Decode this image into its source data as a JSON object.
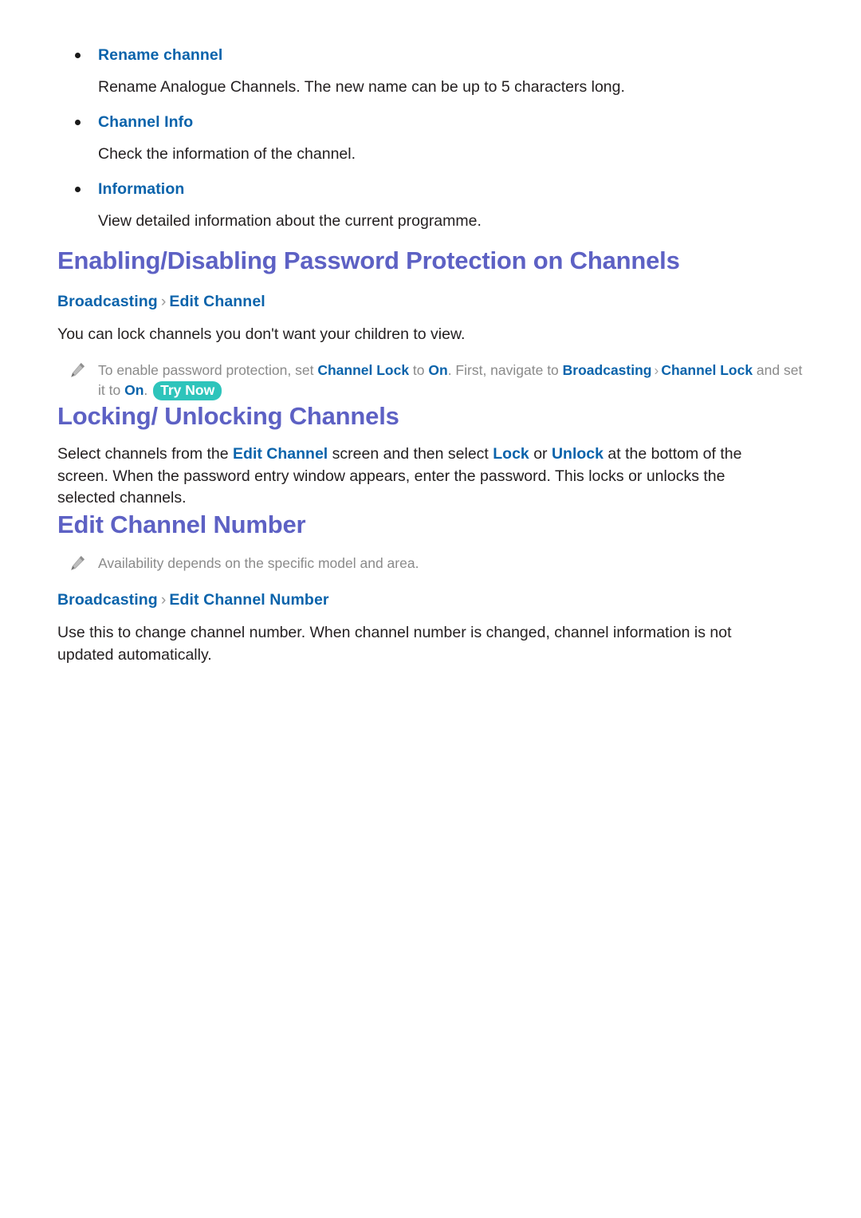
{
  "page": {
    "background": "#ffffff",
    "link_color": "#0a63ab",
    "heading_color": "#5d61c4",
    "body_color": "#231f20",
    "tip_color": "#8a8a8a",
    "badge_color": "#2ec4bb"
  },
  "bullets": [
    {
      "label": "Rename channel",
      "description": "Rename Analogue Channels. The new name can be up to 5 characters long."
    },
    {
      "label": "Channel Info",
      "description": "Check the information of the channel."
    },
    {
      "label": "Information",
      "description": "View detailed information about the current programme."
    }
  ],
  "sections": [
    {
      "title": "Enabling/Disabling Password Protection on Channels",
      "breadcrumb": {
        "root": "Broadcasting",
        "separator": "›",
        "leaf": "Edit Channel"
      },
      "body": "You can lock channels you don't want your children to view.",
      "tip": {
        "icon": "pencil-icon",
        "t1": "To enable password protection, set ",
        "k1": "Channel Lock",
        "t2": " to ",
        "k2": "On",
        "t3": ". First, navigate to ",
        "k3": "Broadcasting",
        "sep": "›",
        "k4": "Channel Lock",
        "t4": " and set it to ",
        "k5": "On",
        "t5": ". ",
        "badge": "Try Now"
      }
    },
    {
      "title": "Locking/ Unlocking Channels",
      "body": {
        "t1": "Select channels from the ",
        "k1": "Edit Channel",
        "t2": " screen and then select ",
        "k2": "Lock",
        "t3": " or ",
        "k3": "Unlock",
        "t4": " at the bottom of the screen. When the password entry window appears, enter the password. This locks or unlocks the selected channels."
      }
    },
    {
      "title": "Edit Channel Number",
      "tip": {
        "icon": "pencil-icon",
        "text": "Availability depends on the specific model and area."
      },
      "breadcrumb": {
        "root": "Broadcasting",
        "separator": "›",
        "leaf": "Edit Channel Number"
      },
      "body": "Use this to change channel number. When channel number is changed, channel information is not updated automatically."
    }
  ]
}
